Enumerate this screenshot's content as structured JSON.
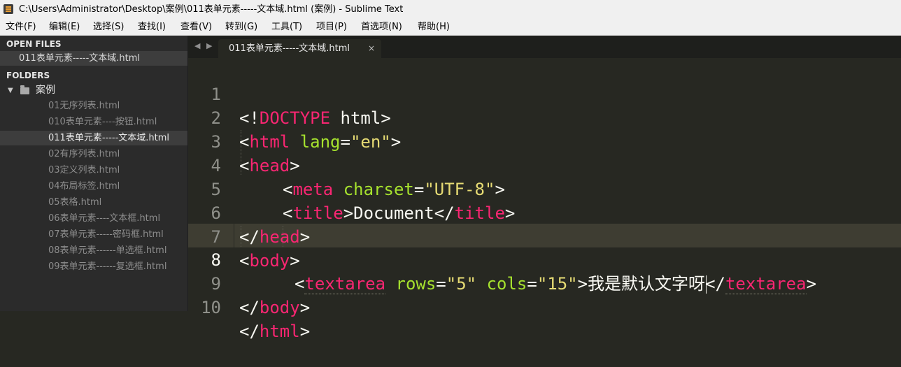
{
  "window": {
    "title": "C:\\Users\\Administrator\\Desktop\\案例\\011表单元素-----文本域.html (案例) - Sublime Text"
  },
  "menu": [
    "文件(F)",
    "编辑(E)",
    "选择(S)",
    "查找(I)",
    "查看(V)",
    "转到(G)",
    "工具(T)",
    "项目(P)",
    "首选项(N)",
    "帮助(H)"
  ],
  "sidebar": {
    "open_files_title": "OPEN FILES",
    "open_files": [
      "011表单元素-----文本域.html"
    ],
    "folders_title": "FOLDERS",
    "folder_name": "案例",
    "files": [
      "01无序列表.html",
      "010表单元素----按钮.html",
      "011表单元素-----文本域.html",
      "02有序列表.html",
      "03定义列表.html",
      "04布局标签.html",
      "05表格.html",
      "06表单元素----文本框.html",
      "07表单元素-----密码框.html",
      "08表单元素------单选框.html",
      "09表单元素------复选框.html"
    ],
    "active_file_index": 2
  },
  "tabs": {
    "nav_left": "◀",
    "nav_right": "▶",
    "active_tab": "011表单元素-----文本域.html",
    "close": "×"
  },
  "editor": {
    "current_line": 8,
    "line_numbers": [
      "1",
      "2",
      "3",
      "4",
      "5",
      "6",
      "7",
      "8",
      "9",
      "10"
    ],
    "tokens": {
      "lt": "<",
      "gt": ">",
      "lt_slash": "</",
      "bang": "!",
      "doctype": "DOCTYPE",
      "html_word": "html",
      "tag_html": "html",
      "attr_lang": "lang",
      "eq": "=",
      "val_en": "\"en\"",
      "tag_head": "head",
      "tag_meta": "meta",
      "attr_charset": "charset",
      "val_utf8": "\"UTF-8\"",
      "tag_title": "title",
      "text_document": "Document",
      "tag_body": "body",
      "tag_textarea": "textarea",
      "attr_rows": "rows",
      "val_rows": "\"5\"",
      "attr_cols": "cols",
      "val_cols": "\"15\"",
      "textarea_text": "我是默认文字呀",
      "sp": " "
    }
  },
  "colors": {
    "editor_bg": "#272822",
    "tag": "#f92672",
    "attribute": "#a6e22e",
    "string": "#e6db74",
    "text": "#f8f8f2",
    "sidebar_bg": "#2b2b2b"
  }
}
